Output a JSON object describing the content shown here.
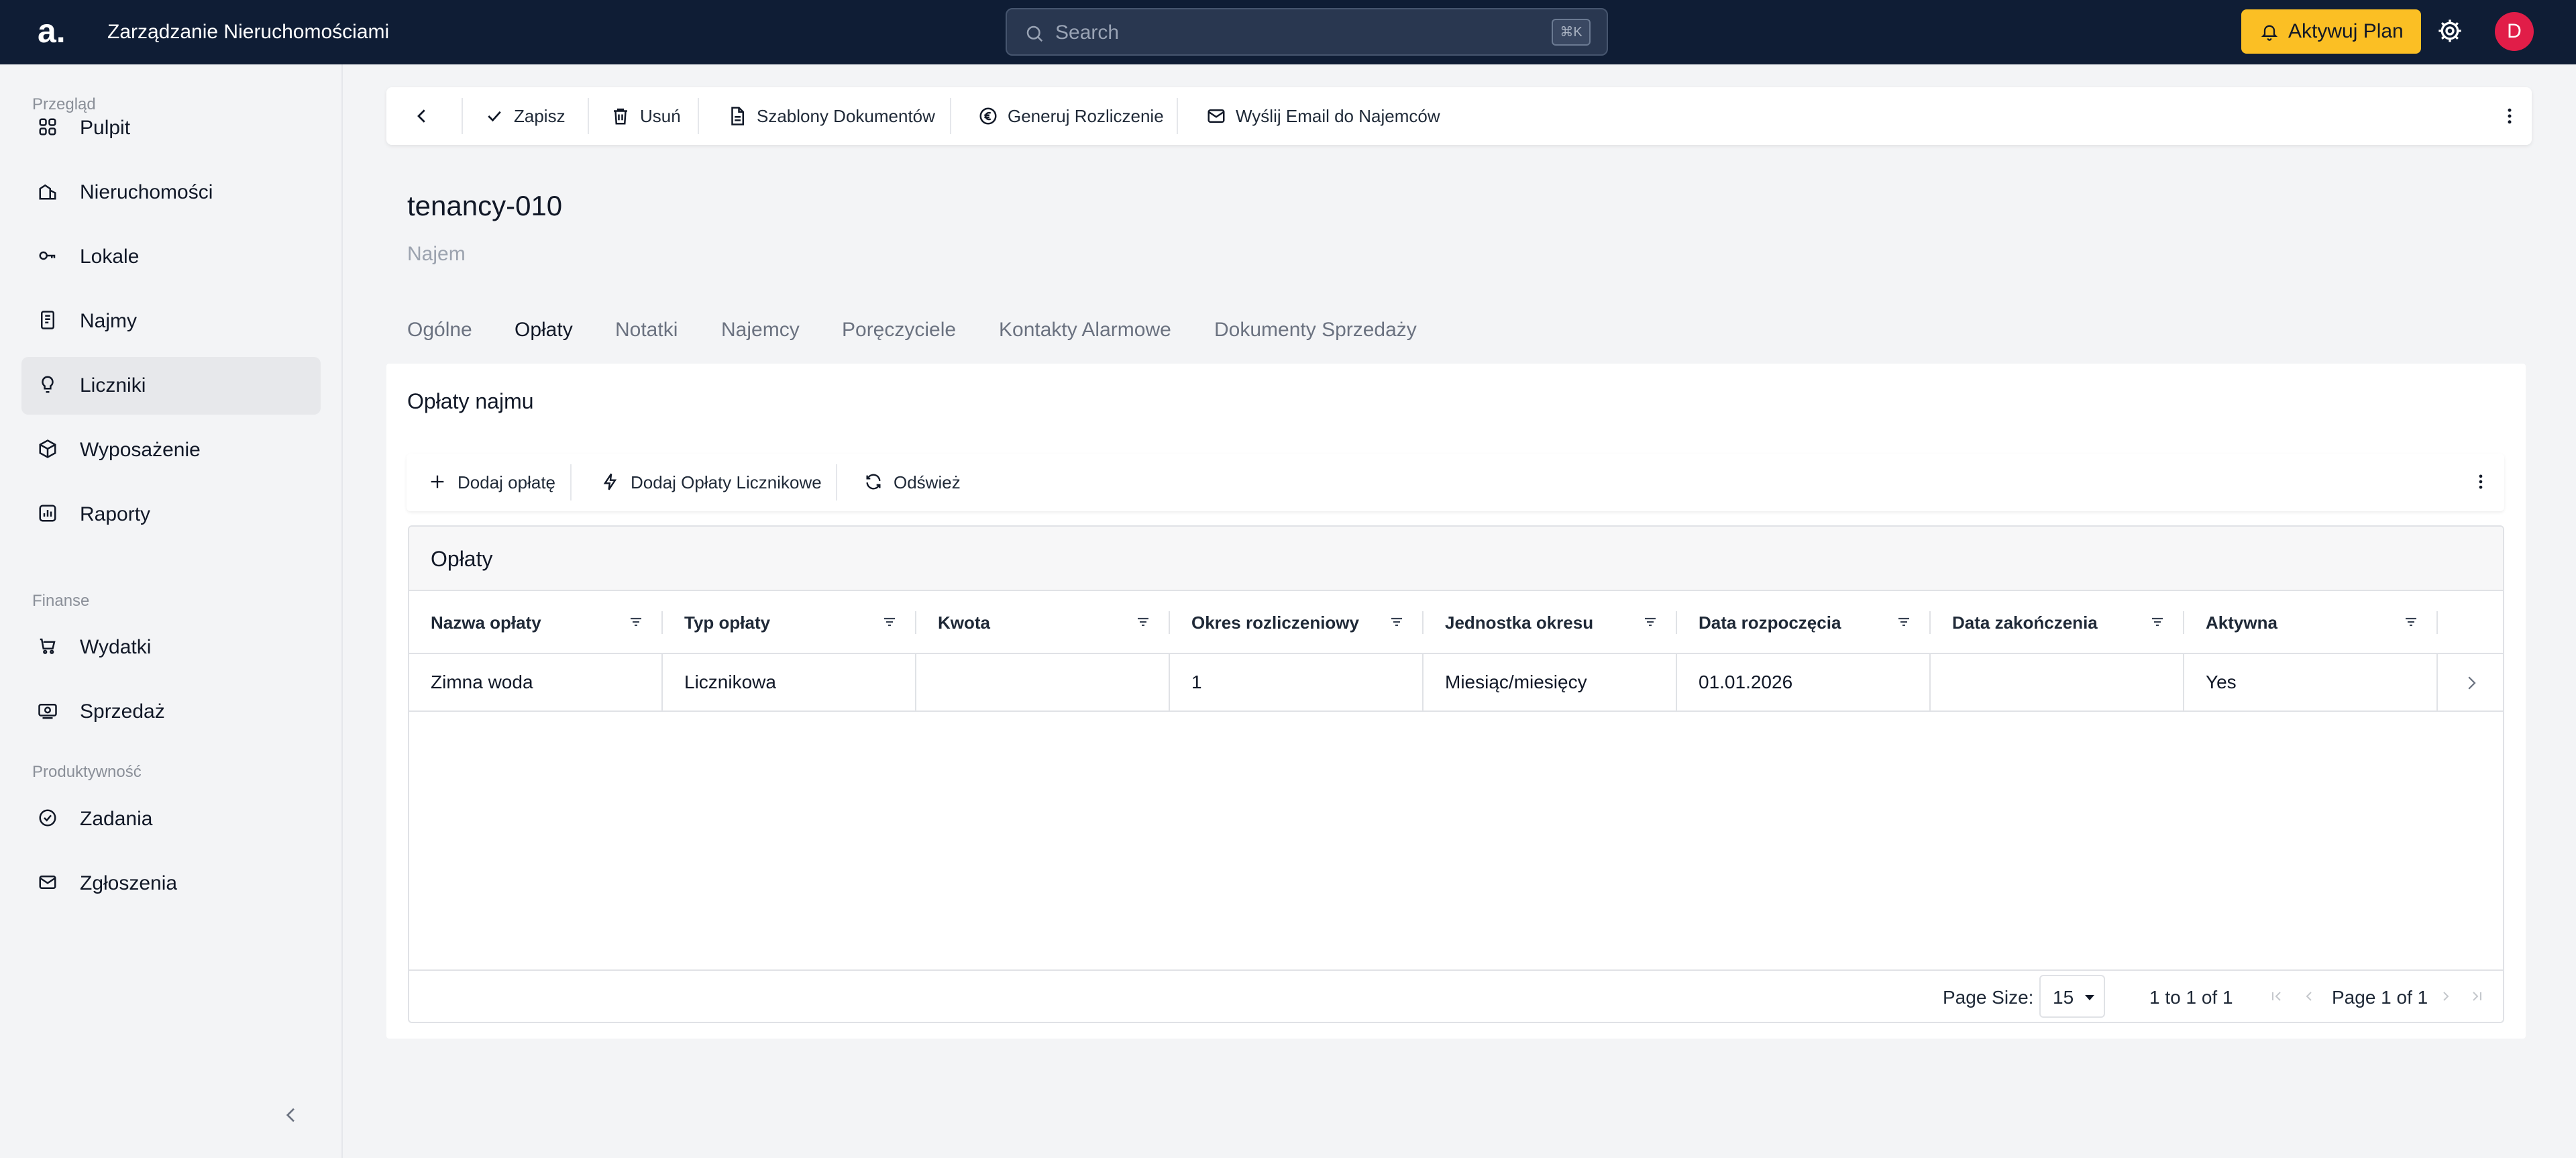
{
  "topbar": {
    "logo": "a.",
    "app_title": "Zarządzanie Nieruchomościami",
    "search_placeholder": "Search",
    "search_shortcut": "⌘K",
    "upgrade_label": "Aktywuj Plan",
    "avatar_initial": "D"
  },
  "sidebar": {
    "sections": [
      "Przegląd",
      "Finanse",
      "Produktywność"
    ],
    "items": [
      {
        "label": "Pulpit",
        "icon": "grid-icon"
      },
      {
        "label": "Nieruchomości",
        "icon": "buildings-icon"
      },
      {
        "label": "Lokale",
        "icon": "key-icon"
      },
      {
        "label": "Najmy",
        "icon": "document-icon"
      },
      {
        "label": "Liczniki",
        "icon": "bulb-icon",
        "active": true
      },
      {
        "label": "Wyposażenie",
        "icon": "box-icon"
      },
      {
        "label": "Raporty",
        "icon": "report-icon"
      },
      {
        "label": "Wydatki",
        "icon": "cart-icon"
      },
      {
        "label": "Sprzedaż",
        "icon": "cash-icon"
      },
      {
        "label": "Zadania",
        "icon": "check-circle-icon"
      },
      {
        "label": "Zgłoszenia",
        "icon": "mail-icon"
      }
    ]
  },
  "toolbar": {
    "save": "Zapisz",
    "delete": "Usuń",
    "templates": "Szablony Dokumentów",
    "settlement": "Generuj Rozliczenie",
    "email": "Wyślij Email do Najemców"
  },
  "page": {
    "title": "tenancy-010",
    "subtitle": "Najem"
  },
  "tabs": [
    "Ogólne",
    "Opłaty",
    "Notatki",
    "Najemcy",
    "Poręczyciele",
    "Kontakty Alarmowe",
    "Dokumenty Sprzedaży"
  ],
  "active_tab": "Opłaty",
  "card": {
    "title": "Opłaty najmu",
    "actions": {
      "add_fee": "Dodaj opłatę",
      "add_meter_fees": "Dodaj Opłaty Licznikowe",
      "refresh": "Odśwież"
    }
  },
  "grid": {
    "title": "Opłaty",
    "columns": [
      "Nazwa opłaty",
      "Typ opłaty",
      "Kwota",
      "Okres rozliczeniowy",
      "Jednostka okresu",
      "Data rozpoczęcia",
      "Data zakończenia",
      "Aktywna"
    ],
    "rows": [
      [
        "Zimna woda",
        "Licznikowa",
        "",
        "1",
        "Miesiąc/miesięcy",
        "01.01.2026",
        "",
        "Yes"
      ]
    ],
    "footer": {
      "page_size_label": "Page Size:",
      "page_size": "15",
      "range": "1 to 1 of 1",
      "page_info": "Page 1 of 1"
    }
  },
  "colors": {
    "topbar_bg": "#0f1d35",
    "accent": "#fbbf24",
    "avatar": "#e11d48"
  }
}
